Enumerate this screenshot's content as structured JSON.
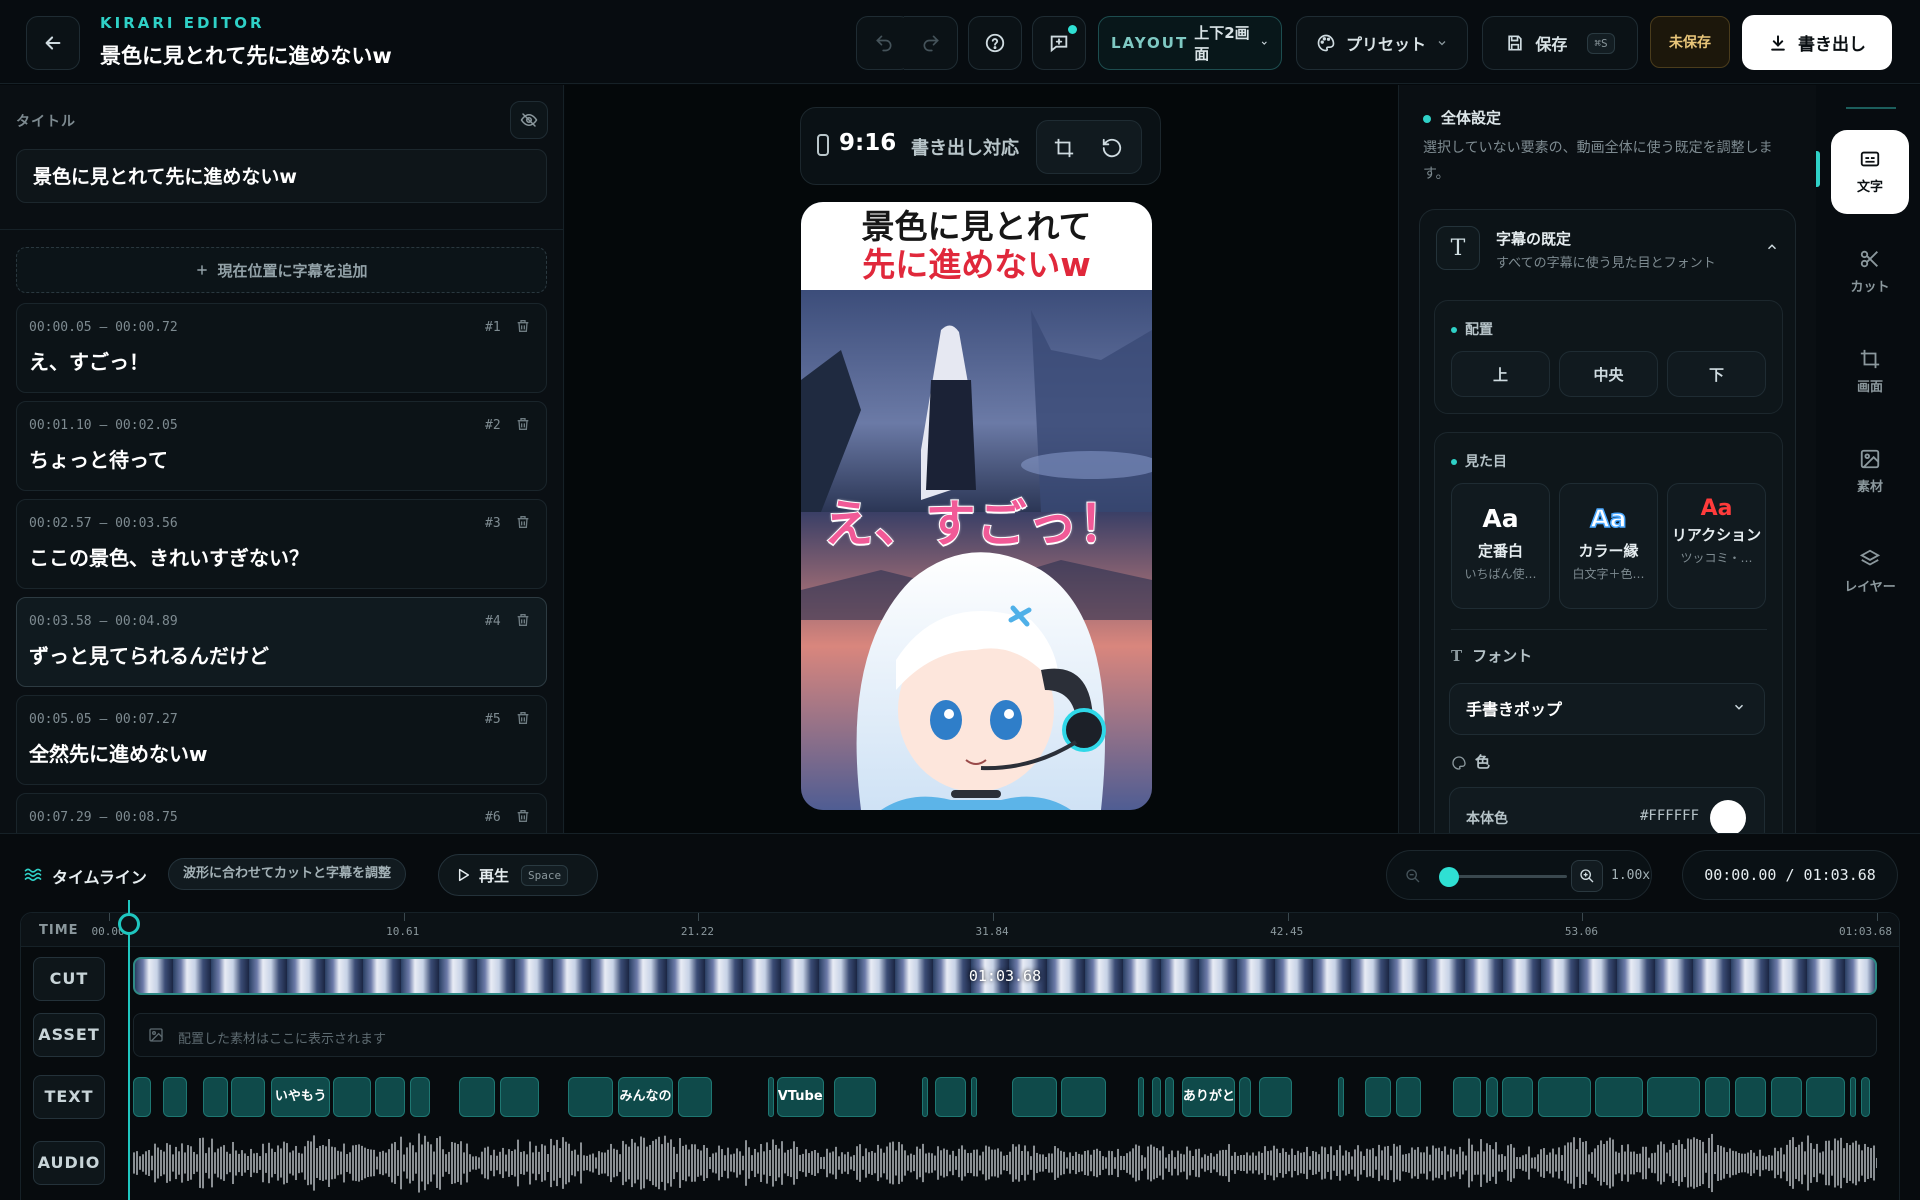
{
  "header": {
    "brand": "KIRARI EDITOR",
    "title": "景色に見とれて先に進めないw",
    "layout_label": "LAYOUT",
    "layout_value": "上下2画面",
    "preset_label": "プリセット",
    "save_label": "保存",
    "save_shortcut": "⌘S",
    "unsaved_label": "未保存",
    "export_label": "書き出し"
  },
  "left": {
    "title_label": "タイトル",
    "title_value": "景色に見とれて先に進めないw",
    "add_subtitle_label": "現在位置に字幕を追加",
    "subtitles": [
      {
        "time": "00:00.05 – 00:00.72",
        "num": "#1",
        "text": "え、すごっ！"
      },
      {
        "time": "00:01.10 – 00:02.05",
        "num": "#2",
        "text": "ちょっと待って"
      },
      {
        "time": "00:02.57 – 00:03.56",
        "num": "#3",
        "text": "ここの景色、きれいすぎない？"
      },
      {
        "time": "00:03.58 – 00:04.89",
        "num": "#4",
        "text": "ずっと見てられるんだけど"
      },
      {
        "time": "00:05.05 – 00:07.27",
        "num": "#5",
        "text": "全然先に進めないw"
      },
      {
        "time": "00:07.29 – 00:08.75",
        "num": "#6",
        "text": ""
      }
    ]
  },
  "preview": {
    "ratio": "9:16",
    "ratio_note": "書き出し対応",
    "header_line1": "景色に見とれて",
    "header_line2": "先に進めないw",
    "subtitle": "え、すごっ！"
  },
  "settings": {
    "section_title": "全体設定",
    "section_desc": "選択していない要素の、動画全体に使う既定を調整します。",
    "card_title": "字幕の既定",
    "card_sub": "すべての字幕に使う見た目とフォント",
    "position_title": "配置",
    "positions": [
      "上",
      "中央",
      "下"
    ],
    "appearance_title": "見た目",
    "styles": [
      {
        "aa": "Aa",
        "name": "定番白",
        "desc": "いちばん使…",
        "color": "#ffffff"
      },
      {
        "aa": "Aa",
        "name": "カラー縁",
        "desc": "白文字＋色…",
        "color": "#9fd3ff"
      },
      {
        "aa": "Aa",
        "name": "リアクション",
        "desc": "ツッコミ・…",
        "color": "#ff3b3b"
      }
    ],
    "font_label": "フォント",
    "font_value": "手書きポップ",
    "color_label": "色",
    "body_color_label": "本体色",
    "body_color_hex": "#FFFFFF"
  },
  "rail": {
    "items": [
      {
        "label": "文字",
        "icon": "subtitle-icon"
      },
      {
        "label": "カット",
        "icon": "scissors-icon"
      },
      {
        "label": "画面",
        "icon": "crop-icon"
      },
      {
        "label": "素材",
        "icon": "image-icon"
      },
      {
        "label": "レイヤー",
        "icon": "layers-icon"
      }
    ]
  },
  "timeline": {
    "title": "タイムライン",
    "hint": "波形に合わせてカットと字幕を調整",
    "play_label": "再生",
    "play_shortcut": "Space",
    "zoom_value": "1.00x",
    "zoom_level": 0.0,
    "time_display": "00:00.00 / 01:03.68",
    "ruler_label": "TIME",
    "ticks": [
      "00.00",
      "10.61",
      "21.22",
      "31.84",
      "42.45",
      "53.06",
      "01:03.68"
    ],
    "tracks": [
      "CUT",
      "ASSET",
      "TEXT",
      "AUDIO"
    ],
    "cut_duration": "01:03.68",
    "asset_hint": "配置した素材はここに表示されます",
    "text_clips": [
      {
        "label": "",
        "start": 0.0,
        "end": 0.72
      },
      {
        "label": "",
        "start": 1.1,
        "end": 2.05
      },
      {
        "label": "",
        "start": 2.57,
        "end": 3.56
      },
      {
        "label": "",
        "start": 3.58,
        "end": 4.89
      },
      {
        "label": "いやもう",
        "start": 5.05,
        "end": 7.27
      },
      {
        "label": "",
        "start": 7.29,
        "end": 8.75
      },
      {
        "label": "",
        "start": 8.85,
        "end": 10.0
      },
      {
        "label": "",
        "start": 10.1,
        "end": 10.9
      },
      {
        "label": "",
        "start": 11.9,
        "end": 13.3
      },
      {
        "label": "",
        "start": 13.4,
        "end": 14.9
      },
      {
        "label": "",
        "start": 15.9,
        "end": 17.6
      },
      {
        "label": "みんなの",
        "start": 17.7,
        "end": 19.8
      },
      {
        "label": "",
        "start": 19.9,
        "end": 21.2
      },
      {
        "label": "",
        "start": 23.2,
        "end": 23.3
      },
      {
        "label": "VTube",
        "start": 23.5,
        "end": 25.3
      },
      {
        "label": "",
        "start": 25.6,
        "end": 27.2
      },
      {
        "label": "",
        "start": 28.8,
        "end": 29.0
      },
      {
        "label": "",
        "start": 29.3,
        "end": 30.5
      },
      {
        "label": "",
        "start": 30.6,
        "end": 30.8
      },
      {
        "label": "",
        "start": 32.1,
        "end": 33.8
      },
      {
        "label": "",
        "start": 33.9,
        "end": 35.6
      },
      {
        "label": "",
        "start": 36.7,
        "end": 37.0
      },
      {
        "label": "",
        "start": 37.2,
        "end": 37.6
      },
      {
        "label": "",
        "start": 37.7,
        "end": 38.1
      },
      {
        "label": "ありがとう",
        "start": 38.3,
        "end": 40.3
      },
      {
        "label": "",
        "start": 40.4,
        "end": 40.9
      },
      {
        "label": "",
        "start": 41.1,
        "end": 42.4
      },
      {
        "label": "",
        "start": 44.0,
        "end": 44.3
      },
      {
        "label": "",
        "start": 45.0,
        "end": 46.0
      },
      {
        "label": "",
        "start": 46.1,
        "end": 47.1
      },
      {
        "label": "",
        "start": 48.2,
        "end": 49.3
      },
      {
        "label": "",
        "start": 49.4,
        "end": 49.9
      },
      {
        "label": "",
        "start": 50.0,
        "end": 51.2
      },
      {
        "label": "",
        "start": 51.3,
        "end": 53.3
      },
      {
        "label": "",
        "start": 53.4,
        "end": 55.2
      },
      {
        "label": "",
        "start": 55.3,
        "end": 57.3
      },
      {
        "label": "",
        "start": 57.4,
        "end": 58.4
      },
      {
        "label": "",
        "start": 58.5,
        "end": 59.7
      },
      {
        "label": "",
        "start": 59.8,
        "end": 61.0
      },
      {
        "label": "",
        "start": 61.1,
        "end": 62.6
      },
      {
        "label": "",
        "start": 62.7,
        "end": 63.0
      },
      {
        "label": "",
        "start": 63.1,
        "end": 63.5
      }
    ]
  },
  "colors": {
    "accent": "#2fd1c7",
    "clip": "#0f4a4a",
    "danger_text": "#e0283b",
    "subtitle_pink": "#f15a97"
  }
}
